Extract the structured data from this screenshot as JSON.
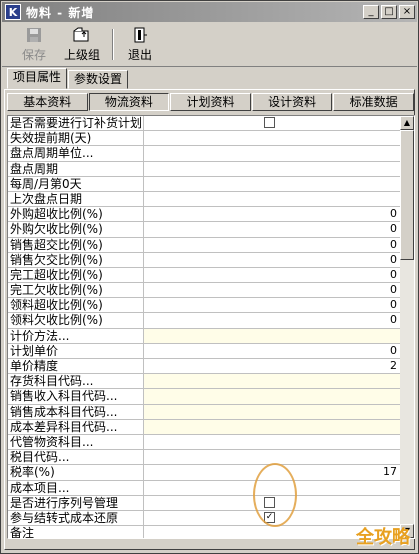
{
  "window": {
    "title": "物料 - 新增",
    "icon_text": "K"
  },
  "toolbar": {
    "save_label": "保存",
    "parent_label": "上级组",
    "exit_label": "退出"
  },
  "outer_tabs": [
    "项目属性",
    "参数设置"
  ],
  "inner_tabs": [
    "基本资料",
    "物流资料",
    "计划资料",
    "设计资料",
    "标准数据"
  ],
  "rows": [
    {
      "name": "是否需要进行订补货计划",
      "value": "",
      "checkbox": true,
      "checked": false
    },
    {
      "name": "失效提前期(天)",
      "value": ""
    },
    {
      "name": "盘点周期单位...",
      "value": ""
    },
    {
      "name": "盘点周期",
      "value": ""
    },
    {
      "name": "每周/月第0天",
      "value": ""
    },
    {
      "name": "上次盘点日期",
      "value": ""
    },
    {
      "name": "外购超收比例(%)",
      "value": "0"
    },
    {
      "name": "外购欠收比例(%)",
      "value": "0"
    },
    {
      "name": "销售超交比例(%)",
      "value": "0"
    },
    {
      "name": "销售欠交比例(%)",
      "value": "0"
    },
    {
      "name": "完工超收比例(%)",
      "value": "0"
    },
    {
      "name": "完工欠收比例(%)",
      "value": "0"
    },
    {
      "name": "领料超收比例(%)",
      "value": "0"
    },
    {
      "name": "领料欠收比例(%)",
      "value": "0"
    },
    {
      "name": "计价方法...",
      "value": "",
      "yellow": true
    },
    {
      "name": "计划单价",
      "value": "0"
    },
    {
      "name": "单价精度",
      "value": "2"
    },
    {
      "name": "存货科目代码...",
      "value": "",
      "yellow": true
    },
    {
      "name": "销售收入科目代码...",
      "value": "",
      "yellow": true
    },
    {
      "name": "销售成本科目代码...",
      "value": "",
      "yellow": true
    },
    {
      "name": "成本差异科目代码...",
      "value": "",
      "yellow": true
    },
    {
      "name": "代管物资科目...",
      "value": ""
    },
    {
      "name": "税目代码...",
      "value": ""
    },
    {
      "name": "税率(%)",
      "value": "17"
    },
    {
      "name": "成本项目...",
      "value": ""
    },
    {
      "name": "是否进行序列号管理",
      "value": "",
      "checkbox": true,
      "checked": false
    },
    {
      "name": "参与结转式成本还原",
      "value": "",
      "checkbox": true,
      "checked": true
    },
    {
      "name": "备注",
      "value": ""
    }
  ],
  "watermark": "全攻略",
  "icons": {
    "save": "floppy-icon",
    "parent": "folder-up-icon",
    "exit": "door-exit-icon"
  }
}
